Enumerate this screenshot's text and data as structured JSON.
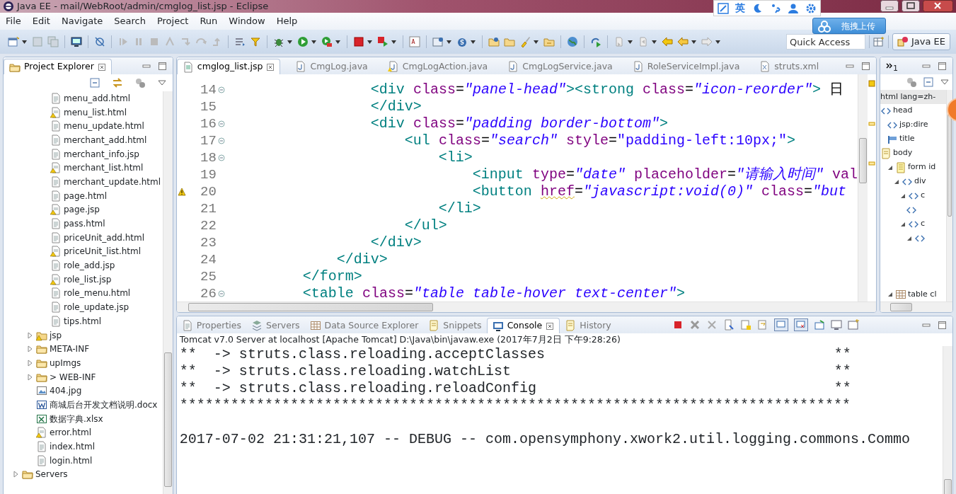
{
  "window": {
    "title": "Java EE - mail/WebRoot/admin/cmglog_list.jsp - Eclipse"
  },
  "ime_bar": {
    "language": "英"
  },
  "upload_widget": {
    "label": "拖拽上传"
  },
  "menu": [
    "File",
    "Edit",
    "Navigate",
    "Search",
    "Project",
    "Run",
    "Window",
    "Help"
  ],
  "toolbar": {
    "quick_access": {
      "placeholder": "Quick Access"
    },
    "perspectives": [
      {
        "label": "Java EE",
        "selected": true
      }
    ]
  },
  "project_explorer": {
    "title": "Project Explorer",
    "tree": [
      {
        "children": [
          {
            "children": [
              {
                "label": "menu_add.html",
                "kind": "file",
                "warning": false
              },
              {
                "label": "menu_list.html",
                "kind": "file",
                "warning": true
              },
              {
                "label": "menu_update.html",
                "kind": "file",
                "warning": false
              },
              {
                "label": "merchant_add.html",
                "kind": "file",
                "warning": false
              },
              {
                "label": "merchant_info.jsp",
                "kind": "file",
                "warning": false
              },
              {
                "label": "merchant_list.html",
                "kind": "file",
                "warning": true
              },
              {
                "label": "merchant_update.html",
                "kind": "file",
                "warning": false
              },
              {
                "label": "page.html",
                "kind": "file",
                "warning": false
              },
              {
                "label": "page.jsp",
                "kind": "file",
                "warning": true
              },
              {
                "label": "pass.html",
                "kind": "file",
                "warning": false
              },
              {
                "label": "priceUnit_add.html",
                "kind": "file",
                "warning": false
              },
              {
                "label": "priceUnit_list.html",
                "kind": "file",
                "warning": true
              },
              {
                "label": "role_add.jsp",
                "kind": "file",
                "warning": false
              },
              {
                "label": "role_list.jsp",
                "kind": "file",
                "warning": true
              },
              {
                "label": "role_menu.html",
                "kind": "file",
                "warning": false
              },
              {
                "label": "role_update.jsp",
                "kind": "file",
                "warning": false
              },
              {
                "label": "tips.html",
                "kind": "file",
                "warning": false
              }
            ]
          },
          {
            "label": "jsp",
            "kind": "folder",
            "expanded": false,
            "warning": true
          },
          {
            "label": "META-INF",
            "kind": "folder",
            "expanded": false,
            "warning": false
          },
          {
            "label": "upImgs",
            "kind": "folder",
            "expanded": false,
            "warning": false
          },
          {
            "label": "> WEB-INF",
            "kind": "folder",
            "expanded": false,
            "warning": false
          },
          {
            "label": "404.jpg",
            "kind": "image",
            "warning": false
          },
          {
            "label": "商城后台开发文档说明.docx",
            "kind": "word",
            "warning": false
          },
          {
            "label": "数据字典.xlsx",
            "kind": "excel",
            "warning": false
          },
          {
            "label": "error.html",
            "kind": "file",
            "warning": true
          },
          {
            "label": "index.html",
            "kind": "file",
            "warning": false
          },
          {
            "label": "login.html",
            "kind": "file",
            "warning": false
          }
        ]
      },
      {
        "label": "Servers",
        "kind": "folder",
        "expanded": false,
        "warning": false
      }
    ]
  },
  "editor": {
    "tabs": [
      {
        "label": "cmglog_list.jsp",
        "kind": "jsp",
        "selected": true
      },
      {
        "label": "CmgLog.java",
        "kind": "java",
        "selected": false
      },
      {
        "label": "CmgLogAction.java",
        "kind": "java-warning",
        "selected": false
      },
      {
        "label": "CmgLogService.java",
        "kind": "java",
        "selected": false
      },
      {
        "label": "RoleServiceImpl.java",
        "kind": "java",
        "selected": false
      },
      {
        "label": "struts.xml",
        "kind": "xml",
        "selected": false
      }
    ],
    "lines": [
      {
        "number": "14",
        "foldable": true,
        "warning": false,
        "tokens": [
          {
            "kind": "tag",
            "text": "                <div"
          },
          {
            "kind": "attr",
            "text": " class"
          },
          {
            "kind": "plain",
            "text": "="
          },
          {
            "kind": "str",
            "text": "\"panel-head\""
          },
          {
            "kind": "tag",
            "text": "><strong"
          },
          {
            "kind": "attr",
            "text": " class"
          },
          {
            "kind": "plain",
            "text": "="
          },
          {
            "kind": "str",
            "text": "\"icon-reorder\""
          },
          {
            "kind": "tag",
            "text": ">"
          },
          {
            "kind": "plain",
            "text": " 日"
          }
        ]
      },
      {
        "number": "15",
        "foldable": false,
        "warning": false,
        "tokens": [
          {
            "kind": "tag",
            "text": "                </div>"
          }
        ]
      },
      {
        "number": "16",
        "foldable": true,
        "warning": false,
        "tokens": [
          {
            "kind": "tag",
            "text": "                <div"
          },
          {
            "kind": "attr",
            "text": " class"
          },
          {
            "kind": "plain",
            "text": "="
          },
          {
            "kind": "str",
            "text": "\"padding border-bottom\""
          },
          {
            "kind": "tag",
            "text": ">"
          }
        ]
      },
      {
        "number": "17",
        "foldable": true,
        "warning": false,
        "tokens": [
          {
            "kind": "tag",
            "text": "                    <ul"
          },
          {
            "kind": "attr",
            "text": " class"
          },
          {
            "kind": "plain",
            "text": "="
          },
          {
            "kind": "str",
            "text": "\"search\""
          },
          {
            "kind": "attr",
            "text": " style"
          },
          {
            "kind": "plain",
            "text": "="
          },
          {
            "kind": "str2",
            "text": "\"padding-left:10px;\""
          },
          {
            "kind": "tag",
            "text": ">"
          }
        ]
      },
      {
        "number": "18",
        "foldable": true,
        "warning": false,
        "tokens": [
          {
            "kind": "tag",
            "text": "                        <li>"
          }
        ]
      },
      {
        "number": "19",
        "foldable": false,
        "warning": false,
        "tokens": [
          {
            "kind": "tag",
            "text": "                            <input"
          },
          {
            "kind": "attr",
            "text": " type"
          },
          {
            "kind": "plain",
            "text": "="
          },
          {
            "kind": "str",
            "text": "\"date\""
          },
          {
            "kind": "attr",
            "text": " placeholder"
          },
          {
            "kind": "plain",
            "text": "="
          },
          {
            "kind": "str",
            "text": "\"请输入时间\""
          },
          {
            "kind": "attr",
            "text": " val"
          }
        ]
      },
      {
        "number": "20",
        "foldable": false,
        "warning": true,
        "tokens": [
          {
            "kind": "tag",
            "text": "                            <button "
          },
          {
            "kind": "attr-warn",
            "text": "href"
          },
          {
            "kind": "plain",
            "text": "="
          },
          {
            "kind": "str",
            "text": "\"javascript:void(0)\""
          },
          {
            "kind": "attr",
            "text": " class"
          },
          {
            "kind": "plain",
            "text": "="
          },
          {
            "kind": "str",
            "text": "\"but"
          }
        ]
      },
      {
        "number": "21",
        "foldable": false,
        "warning": false,
        "tokens": [
          {
            "kind": "tag",
            "text": "                        </li>"
          }
        ]
      },
      {
        "number": "22",
        "foldable": false,
        "warning": false,
        "tokens": [
          {
            "kind": "tag",
            "text": "                    </ul>"
          }
        ]
      },
      {
        "number": "23",
        "foldable": false,
        "warning": false,
        "tokens": [
          {
            "kind": "tag",
            "text": "                </div>"
          }
        ]
      },
      {
        "number": "24",
        "foldable": false,
        "warning": false,
        "tokens": [
          {
            "kind": "tag",
            "text": "            </div>"
          }
        ]
      },
      {
        "number": "25",
        "foldable": false,
        "warning": false,
        "tokens": [
          {
            "kind": "tag",
            "text": "        </form>"
          }
        ]
      },
      {
        "number": "26",
        "foldable": true,
        "warning": false,
        "tokens": [
          {
            "kind": "tag",
            "text": "        <table"
          },
          {
            "kind": "attr",
            "text": " class"
          },
          {
            "kind": "plain",
            "text": "="
          },
          {
            "kind": "str",
            "text": "\"table table-hover text-center\""
          },
          {
            "kind": "tag",
            "text": ">"
          }
        ]
      }
    ]
  },
  "outline": {
    "overflow_count": "1",
    "root_label": "html lang=zh-",
    "items": [
      {
        "label": "head",
        "kind": "tag",
        "children": [
          {
            "label": "jsp:dire",
            "kind": "tag"
          },
          {
            "label": "title",
            "kind": "title"
          }
        ]
      },
      {
        "label": "body",
        "kind": "page",
        "children": [
          {
            "label": "form id",
            "kind": "form",
            "expanded": true,
            "children": [
              {
                "label": "div",
                "kind": "tag",
                "expanded": true,
                "children": [
                  {
                    "label": "c",
                    "kind": "tag",
                    "expanded": true,
                    "children": [
                      {
                        "kind": "tag"
                      }
                    ]
                  },
                  {
                    "label": "c",
                    "kind": "tag",
                    "expanded": true,
                    "children": [
                      {
                        "kind": "tag",
                        "expanded": true
                      }
                    ]
                  }
                ]
              }
            ]
          },
          {
            "label": "table cl",
            "kind": "table",
            "expanded": true
          }
        ]
      }
    ]
  },
  "bottom_panel": {
    "tabs": [
      {
        "label": "Properties",
        "kind": "properties",
        "selected": false
      },
      {
        "label": "Servers",
        "kind": "servers",
        "selected": false
      },
      {
        "label": "Data Source Explorer",
        "kind": "datasource",
        "selected": false
      },
      {
        "label": "Snippets",
        "kind": "snippets",
        "selected": false
      },
      {
        "label": "Console",
        "kind": "console",
        "selected": true
      },
      {
        "label": "History",
        "kind": "history",
        "selected": false
      }
    ],
    "process": "Tomcat v7.0 Server at localhost [Apache Tomcat] D:\\Java\\bin\\javaw.exe (2017年7月2日 下午9:28:26)",
    "lines": [
      {
        "kind": "banner",
        "text": "**  -> struts.class.reloading.acceptClasses",
        "end": "**"
      },
      {
        "kind": "banner",
        "text": "**  -> struts.class.reloading.watchList",
        "end": "**"
      },
      {
        "kind": "banner",
        "text": "**  -> struts.class.reloading.reloadConfig",
        "end": "**"
      },
      {
        "kind": "plain",
        "text": "*******************************************************************************"
      },
      {
        "kind": "blank"
      },
      {
        "kind": "plain",
        "text": "2017-07-02 21:31:21,107 -- DEBUG -- com.opensymphony.xwork2.util.logging.commons.Commo"
      }
    ]
  }
}
